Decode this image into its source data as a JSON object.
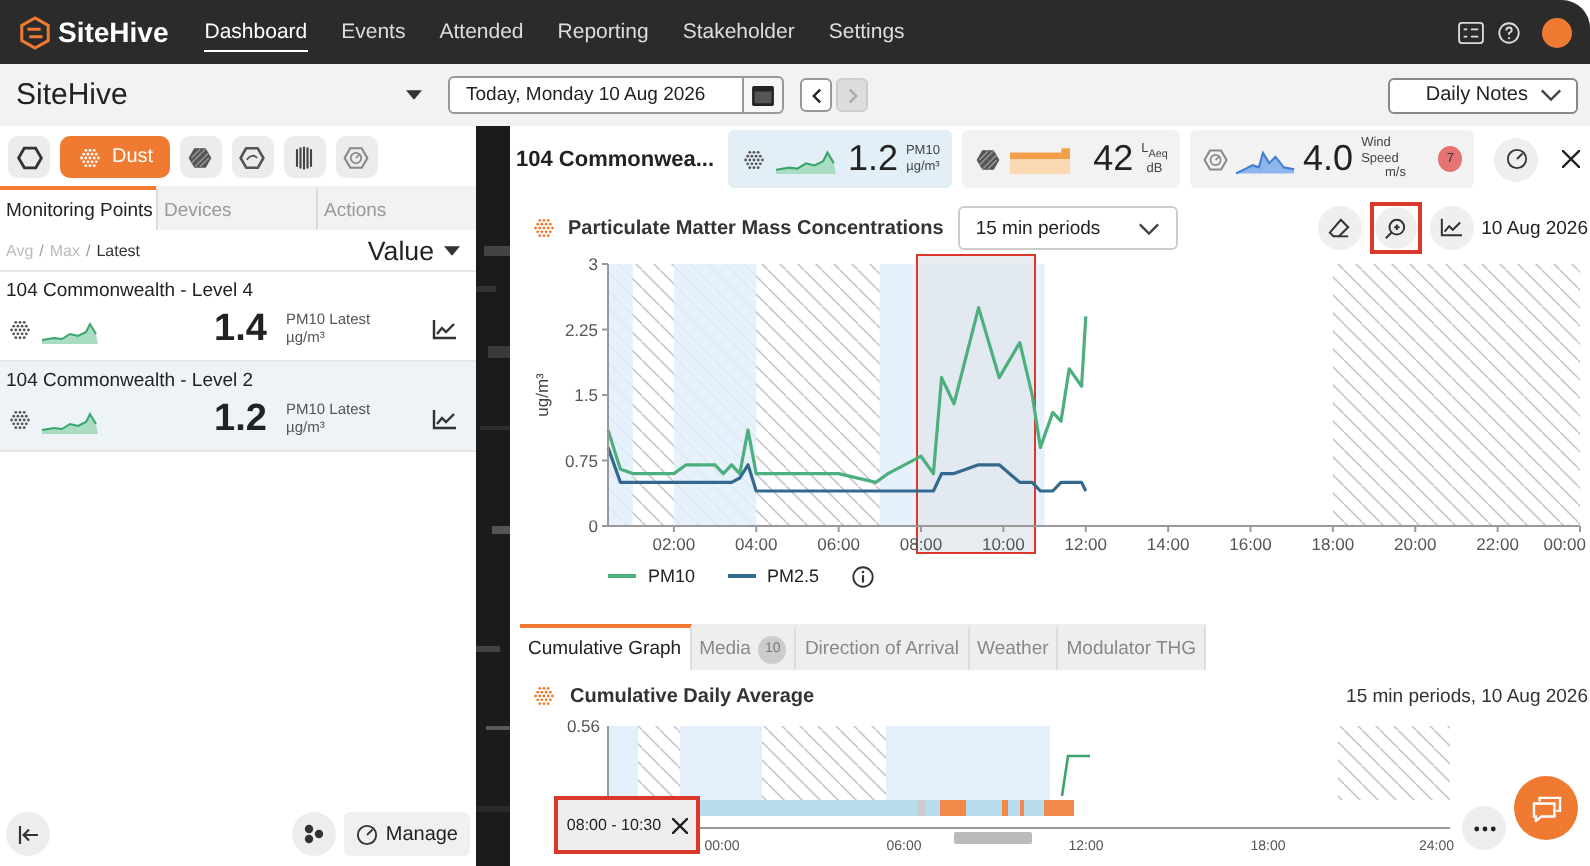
{
  "nav": {
    "brand": "SiteHive",
    "items": [
      {
        "label": "Dashboard",
        "selected": true
      },
      {
        "label": "Events",
        "selected": false
      },
      {
        "label": "Attended",
        "selected": false
      },
      {
        "label": "Reporting",
        "selected": false
      },
      {
        "label": "Stakeholder",
        "selected": false
      },
      {
        "label": "Settings",
        "selected": false
      }
    ]
  },
  "toolbar": {
    "site": "SiteHive",
    "date": "Today, Monday 10 Aug 2026",
    "prev": {
      "disabled": false
    },
    "next": {
      "disabled": true
    },
    "notes": "Daily Notes"
  },
  "sidebar": {
    "filters": [
      {
        "kind": "outline",
        "selected": false
      },
      {
        "kind": "dust",
        "label": "Dust",
        "selected": true
      },
      {
        "kind": "noise",
        "selected": false
      },
      {
        "kind": "vibration",
        "selected": false
      },
      {
        "kind": "striped",
        "selected": false
      },
      {
        "kind": "weather",
        "selected": false
      }
    ],
    "tabs": [
      {
        "label": "Monitoring Points",
        "selected": true
      },
      {
        "label": "Devices",
        "selected": false
      },
      {
        "label": "Actions",
        "selected": false
      }
    ],
    "modes": [
      {
        "label": "Avg",
        "selected": false
      },
      {
        "label": "Max",
        "selected": false
      },
      {
        "label": "Latest",
        "selected": true
      }
    ],
    "separator": "/",
    "sort": "Value",
    "points": [
      {
        "name": "104 Commonwealth - Level 4",
        "value": "1.4",
        "metric": "PM10 Latest",
        "unit": "µg/m³",
        "selected": false
      },
      {
        "name": "104 Commonwealth - Level 2",
        "value": "1.2",
        "metric": "PM10 Latest",
        "unit": "µg/m³",
        "selected": true
      }
    ],
    "manage": "Manage"
  },
  "panel": {
    "title": "104 Commonwea...",
    "metrics": [
      {
        "kind": "dust",
        "value": "1.2",
        "label": "PM10",
        "unit": "µg/m³",
        "selected": true
      },
      {
        "kind": "noise",
        "value": "42",
        "label": "L$_{Aeq}$",
        "unit": "dB",
        "selected": false
      },
      {
        "kind": "wind",
        "value": "4.0",
        "label": "Wind Speed",
        "unit": "m/s",
        "badge": "7",
        "selected": false
      }
    ],
    "chart": {
      "title": "Particulate Matter Mass Concentrations",
      "period": "15 min periods",
      "tools": [
        {
          "kind": "erase",
          "highlighted": false
        },
        {
          "kind": "zoom",
          "highlighted": true
        },
        {
          "kind": "chart",
          "highlighted": false
        }
      ],
      "date": "10 Aug 2026",
      "chart_data": {
        "type": "line",
        "ylabel": "ug/m³",
        "xlim": [
          0.4,
          24
        ],
        "ylim": [
          0,
          3
        ],
        "yticks": [
          0,
          0.75,
          1.5,
          2.25,
          3
        ],
        "xticks": [
          {
            "value": 2,
            "label": "02:00"
          },
          {
            "value": 4,
            "label": "04:00"
          },
          {
            "value": 6,
            "label": "06:00"
          },
          {
            "value": 8,
            "label": "08:00"
          },
          {
            "value": 10,
            "label": "10:00"
          },
          {
            "value": 12,
            "label": "12:00"
          },
          {
            "value": 14,
            "label": "14:00"
          },
          {
            "value": 16,
            "label": "16:00"
          },
          {
            "value": 18,
            "label": "18:00"
          },
          {
            "value": 20,
            "label": "20:00"
          },
          {
            "value": 22,
            "label": "22:00"
          },
          {
            "value": 24,
            "label": "00:00"
          }
        ],
        "x": [
          0.4,
          0.7,
          1,
          2,
          2.3,
          3,
          3.2,
          3.4,
          3.6,
          3.8,
          4,
          6,
          6.9,
          7.2,
          8,
          8.3,
          8.5,
          8.8,
          9.4,
          9.9,
          10.4,
          10.7,
          10.9,
          11.2,
          11.4,
          11.6,
          11.9,
          12
        ],
        "series": [
          {
            "name": "PM10",
            "color": "#4caf7d",
            "values": [
              1.1,
              0.65,
              0.6,
              0.6,
              0.7,
              0.7,
              0.6,
              0.7,
              0.6,
              1.1,
              0.6,
              0.6,
              0.5,
              0.6,
              0.8,
              0.6,
              1.7,
              1.4,
              2.5,
              1.7,
              2.1,
              1.5,
              0.9,
              1.3,
              1.2,
              1.8,
              1.6,
              2.4
            ]
          },
          {
            "name": "PM2.5",
            "color": "#33698f",
            "values": [
              0.9,
              0.5,
              0.5,
              0.5,
              0.5,
              0.5,
              0.5,
              0.5,
              0.55,
              0.7,
              0.4,
              0.4,
              0.4,
              0.4,
              0.4,
              0.4,
              0.6,
              0.6,
              0.7,
              0.7,
              0.5,
              0.5,
              0.4,
              0.4,
              0.5,
              0.5,
              0.5,
              0.4
            ]
          }
        ]
      },
      "selection": {
        "highlighted": true
      }
    },
    "tabs": [
      {
        "label": "Cumulative Graph",
        "selected": true
      },
      {
        "label": "Media",
        "badge": "10",
        "selected": false
      },
      {
        "label": "Direction of Arrival",
        "selected": false
      },
      {
        "label": "Weather",
        "selected": false
      },
      {
        "label": "Modulator THG",
        "selected": false
      }
    ],
    "cumulative": {
      "title": "Cumulative Daily Average",
      "subtitle": "15 min periods, 10 Aug 2026",
      "y_label": "0.56",
      "x_labels": [
        "00:00",
        "06:00",
        "12:00",
        "18:00",
        "24:00"
      ],
      "range_chip": {
        "label": "08:00 - 10:30",
        "highlighted": true
      }
    }
  }
}
